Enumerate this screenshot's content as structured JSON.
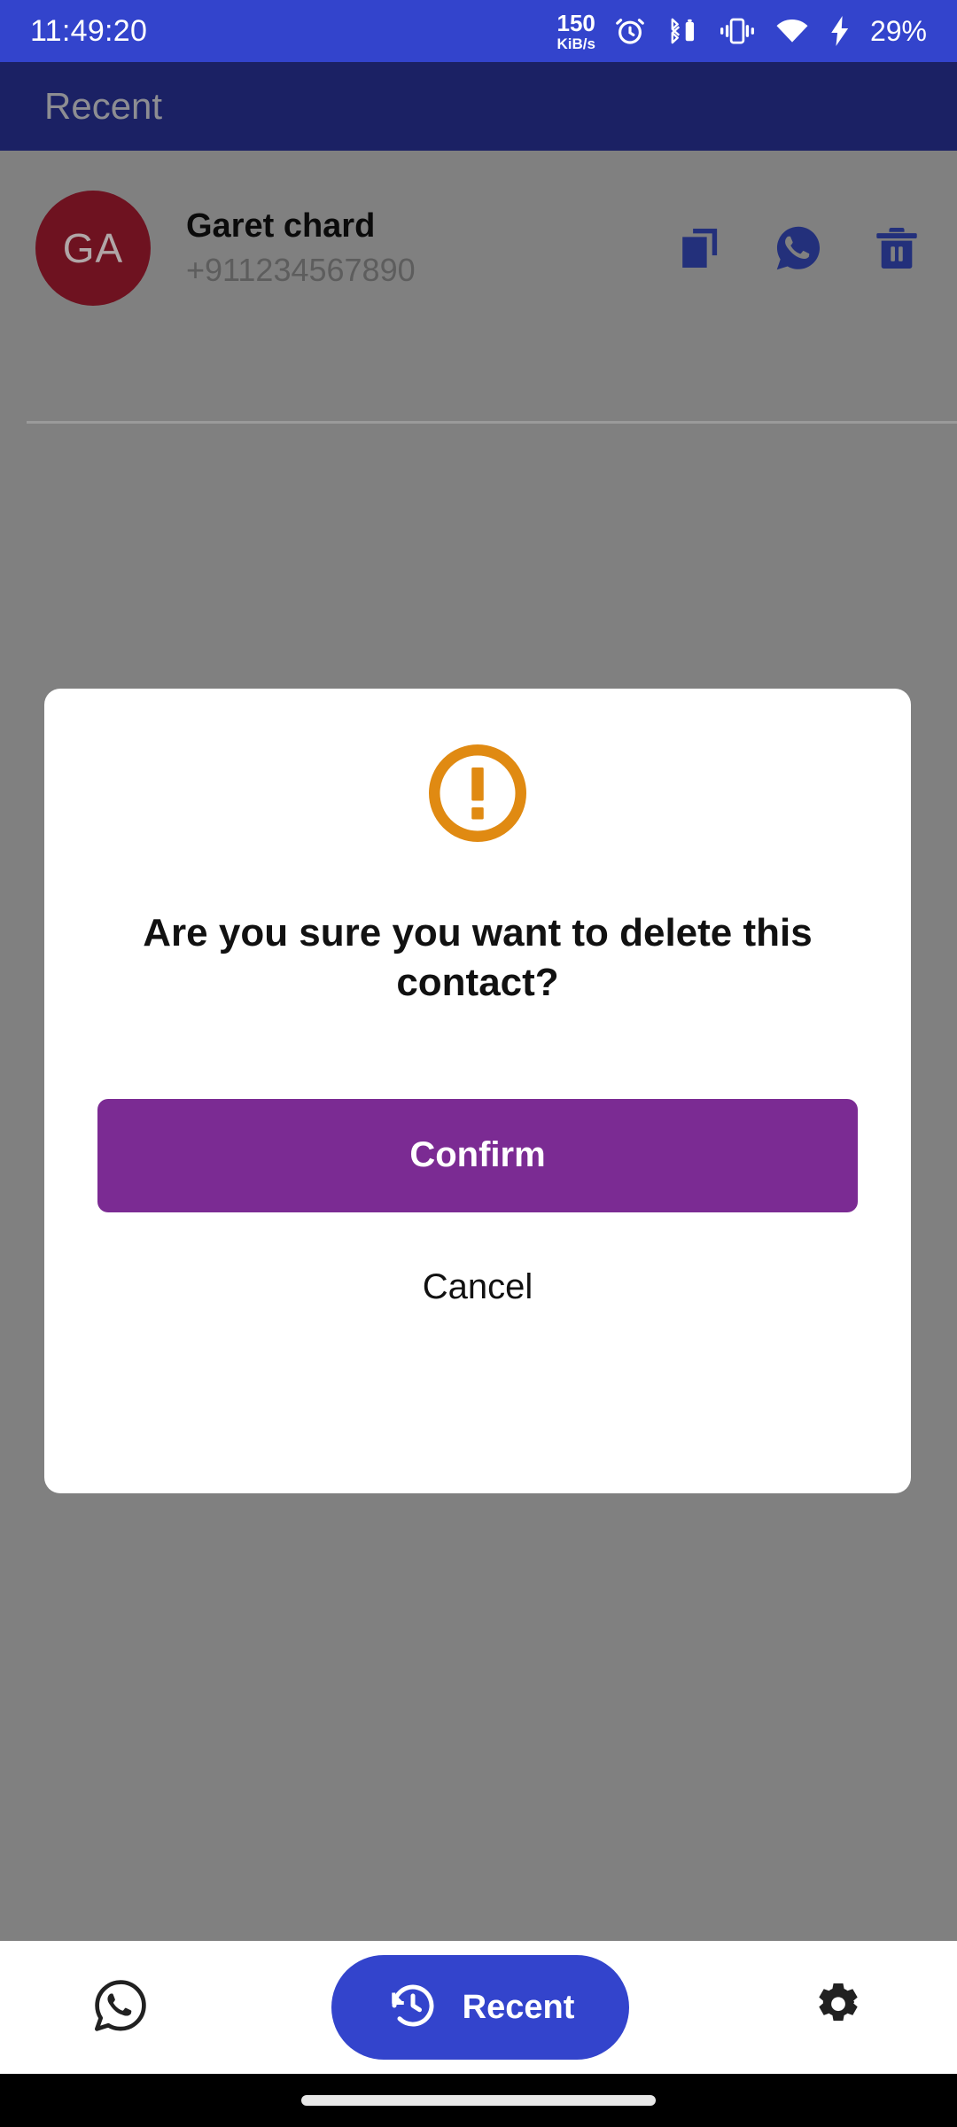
{
  "status_bar": {
    "clock": "11:49:20",
    "net_speed_value": "150",
    "net_speed_unit": "KiB/s",
    "icons": [
      "alarm-icon",
      "bluetooth-battery-icon",
      "vibrate-icon",
      "wifi-icon",
      "charging-bolt-icon"
    ],
    "battery_percent": "29%",
    "background_color": "#3344CC"
  },
  "app_bar": {
    "title": "Recent",
    "background_color": "#1B2164",
    "title_color": "#8D8D92"
  },
  "contact": {
    "avatar_initials": "GA",
    "avatar_color": "#6E1220",
    "name": "Garet chard",
    "phone": "+911234567890",
    "actions": [
      {
        "name": "copy-icon",
        "label": "Copy"
      },
      {
        "name": "whatsapp-icon",
        "label": "WhatsApp"
      },
      {
        "name": "delete-icon",
        "label": "Delete"
      }
    ],
    "action_icon_color": "#23307B"
  },
  "dialog": {
    "warning_icon": "warning-exclamation-circle-icon",
    "warning_icon_color": "#E08A12",
    "message": "Are you sure you want to delete this contact?",
    "confirm_label": "Confirm",
    "confirm_color": "#7B2B93",
    "cancel_label": "Cancel",
    "background_color": "#FFFFFF"
  },
  "scrim": {
    "color": "#808080"
  },
  "bottom_nav": {
    "items": [
      {
        "icon": "whatsapp-icon",
        "label": "",
        "active": false
      },
      {
        "icon": "history-icon",
        "label": "Recent",
        "active": true
      },
      {
        "icon": "gear-icon",
        "label": "",
        "active": false
      }
    ],
    "active_label": "Recent",
    "active_color": "#3344CC",
    "inactive_icon_color": "#212121"
  },
  "gesture_bar": {
    "background_color": "#000000",
    "handle_color": "#E8E8E8"
  }
}
